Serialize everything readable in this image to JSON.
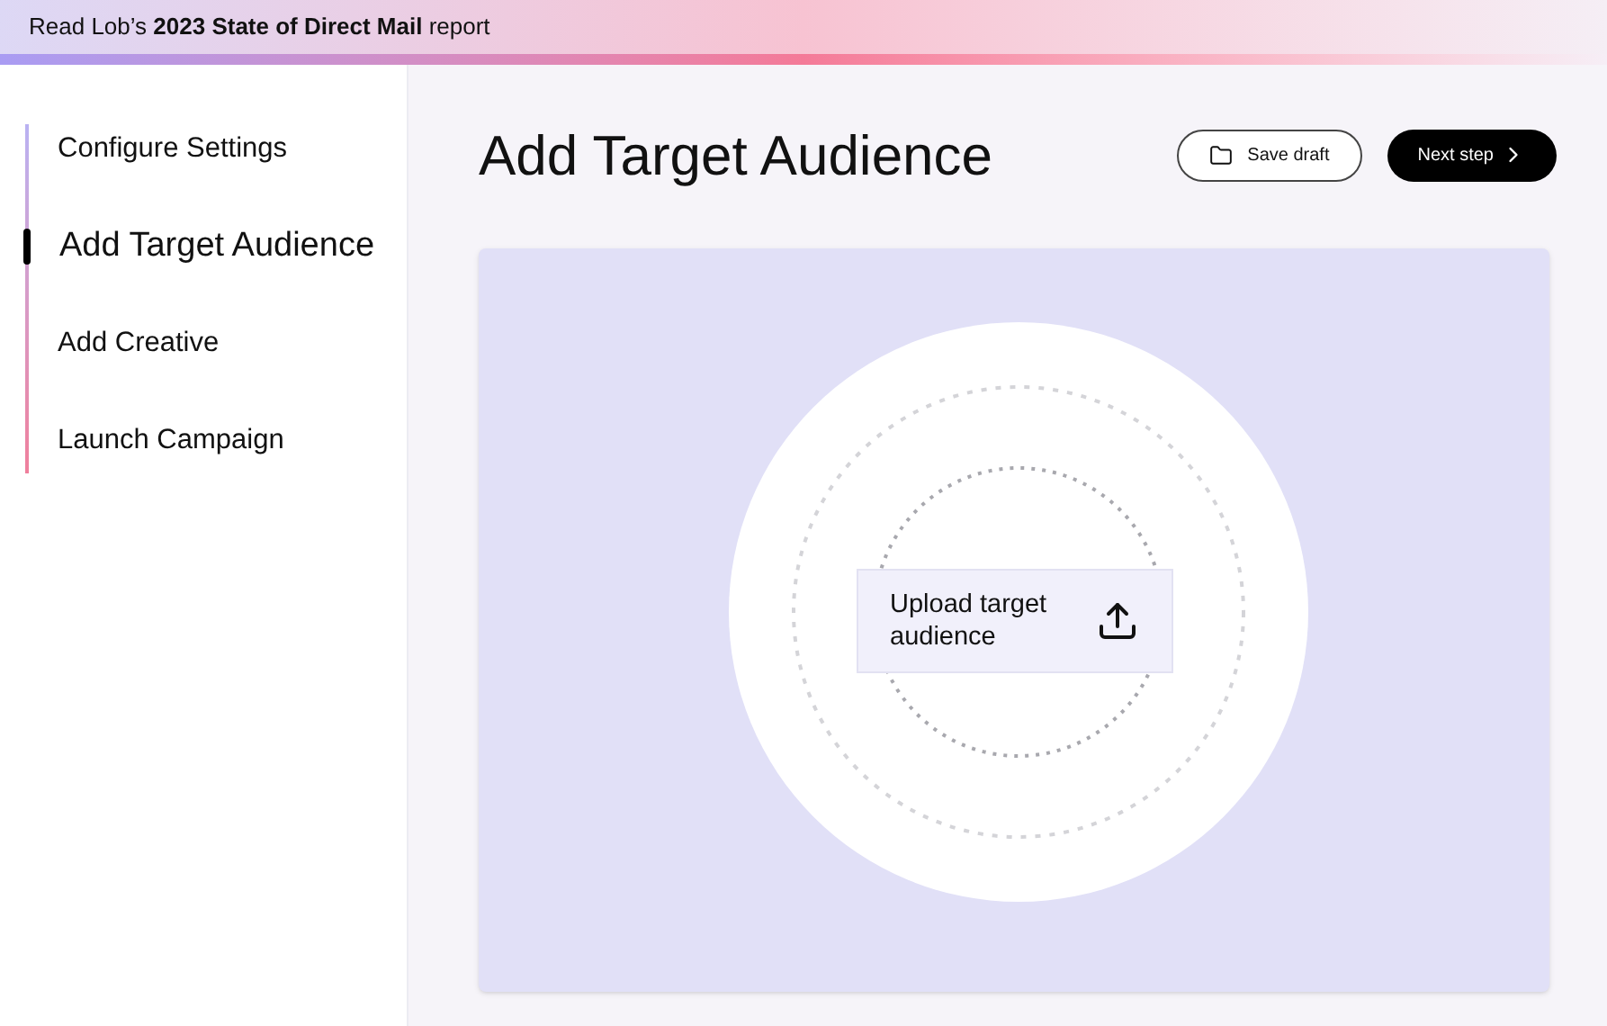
{
  "banner": {
    "text": "Read Lob’s **2023 State of Direct Mail** report"
  },
  "steps": [
    {
      "label": "Configure Settings",
      "selected": false
    },
    {
      "label": "Add Target Audience",
      "selected": true
    },
    {
      "label": "Add Creative",
      "selected": false
    },
    {
      "label": "Launch Campaign",
      "selected": false
    }
  ],
  "page": {
    "title": "Add Target Audience"
  },
  "buttons": {
    "save_draft": "Save draft",
    "next_step": "Next step"
  },
  "upload": {
    "label": "Upload target audience"
  }
}
